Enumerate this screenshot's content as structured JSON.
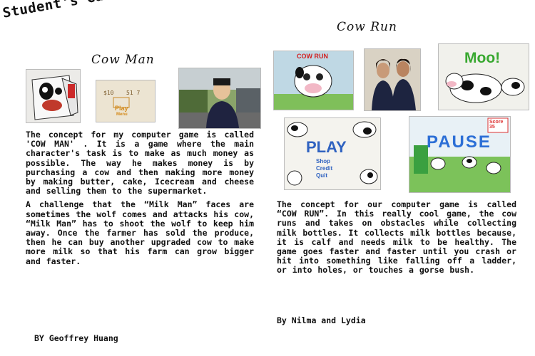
{
  "page": {
    "title": "Student's Game Concepts:",
    "left": {
      "heading": "Cow Man",
      "paragraph1": "The concept for my computer game is called 'COW MAN' . It is a game where the main character's task is to make as much money as possible. The way he makes money is by purchasing a cow and then making more money by making butter, cake, Icecream and cheese and selling them to the supermarket.",
      "paragraph2": "A challenge that the “Milk Man” faces are sometimes the wolf comes and attacks his cow, “Milk Man” has to shoot the wolf to keep him away. Once the farmer has sold the produce, then he can buy another upgraded cow to make more milk so that his farm can grow bigger and faster.",
      "byline": "BY Geoffrey Huang",
      "drawing_text": "Play",
      "drawing_sub": "Menu"
    },
    "right": {
      "heading": "Cow Run",
      "paragraph": "The concept for our computer game is called “COW RUN”. In this really cool game, the cow runs and takes on obstacles while collecting milk bottles. It collects milk bottles because, it is calf and needs milk to be healthy. The game goes faster and faster until you crash or hit into something like falling off a ladder, or into holes, or touches a gorse bush.",
      "byline": "By Nilma and Lydia",
      "drawing_title": "COW RUN",
      "play_text": "PLAY",
      "menu_items": [
        "Shop",
        "Credit",
        "Quit"
      ],
      "moo_text": "Moo!",
      "score_text": "Score 35",
      "pause_text": "PAUSE"
    }
  }
}
